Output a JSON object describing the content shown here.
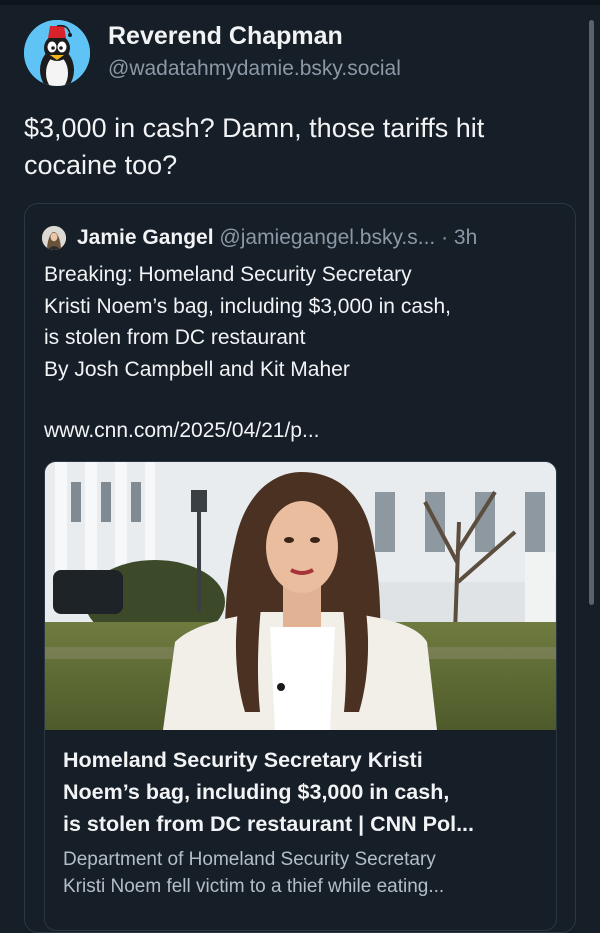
{
  "post": {
    "author_name": "Reverend Chapman",
    "author_handle": "@wadatahmydamie.bsky.social",
    "text_line1": "$3,000 in cash? Damn, those tariffs hit",
    "text_line2": "cocaine too?"
  },
  "quote": {
    "author_name": "Jamie Gangel",
    "author_handle": "@jamiegangel.bsky.s...",
    "time": "· 3h",
    "body_lines": [
      "Breaking: Homeland Security Secretary",
      "Kristi Noem’s bag, including $3,000 in cash,",
      "is stolen from DC restaurant",
      "By Josh Campbell and Kit Maher"
    ],
    "link_text": "www.cnn.com/2025/04/21/p..."
  },
  "link_card": {
    "title_lines": [
      "Homeland Security Secretary Kristi",
      "Noem’s bag, including $3,000 in cash,",
      "is stolen from DC restaurant | CNN Pol..."
    ],
    "description_lines": [
      "Department of Homeland Security Secretary",
      "Kristi Noem fell victim to a thief while eating..."
    ]
  },
  "icons": {
    "author_avatar": "penguin-avatar-icon",
    "quote_avatar": "person-avatar-icon"
  },
  "colors": {
    "background": "#161e27",
    "text_primary": "#f1f3f5",
    "text_secondary": "#8b98a6",
    "border": "#2c3744"
  }
}
